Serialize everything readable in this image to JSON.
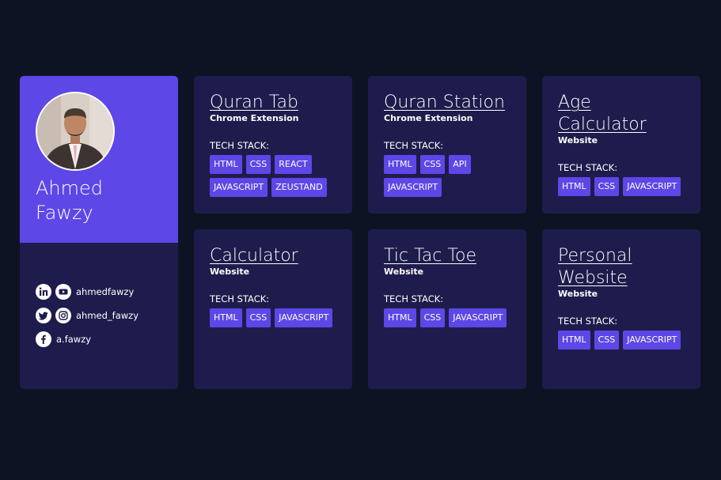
{
  "profile": {
    "first_name": "Ahmed",
    "last_name": "Fawzy",
    "avatar_alt": "Ahmed Fawzy portrait",
    "socials": [
      {
        "icons": [
          "linkedin-icon",
          "youtube-icon"
        ],
        "handle": "ahmedfawzy"
      },
      {
        "icons": [
          "twitter-icon",
          "instagram-icon"
        ],
        "handle": "ahmed_fawzy"
      },
      {
        "icons": [
          "facebook-icon"
        ],
        "handle": "a.fawzy"
      }
    ]
  },
  "stack_label": "TECH STACK:",
  "projects": [
    {
      "title": "Quran Tab",
      "type": "Chrome Extension",
      "tags": [
        "HTML",
        "CSS",
        "REACT",
        "JAVASCRIPT",
        "ZEUSTAND"
      ]
    },
    {
      "title": "Quran Station",
      "type": "Chrome Extension",
      "tags": [
        "HTML",
        "CSS",
        "API",
        "JAVASCRIPT"
      ]
    },
    {
      "title": "Age Calculator",
      "type": "Website",
      "tags": [
        "HTML",
        "CSS",
        "JAVASCRIPT"
      ]
    },
    {
      "title": "Calculator",
      "type": "Website",
      "tags": [
        "HTML",
        "CSS",
        "JAVASCRIPT"
      ]
    },
    {
      "title": "Tic Tac Toe",
      "type": "Website",
      "tags": [
        "HTML",
        "CSS",
        "JAVASCRIPT"
      ]
    },
    {
      "title": "Personal Website",
      "type": "Website",
      "tags": [
        "HTML",
        "CSS",
        "JAVASCRIPT"
      ]
    }
  ],
  "colors": {
    "background": "#0e1323",
    "card": "#1e1c4c",
    "accent": "#5d47e7",
    "text": "#ffffff"
  }
}
